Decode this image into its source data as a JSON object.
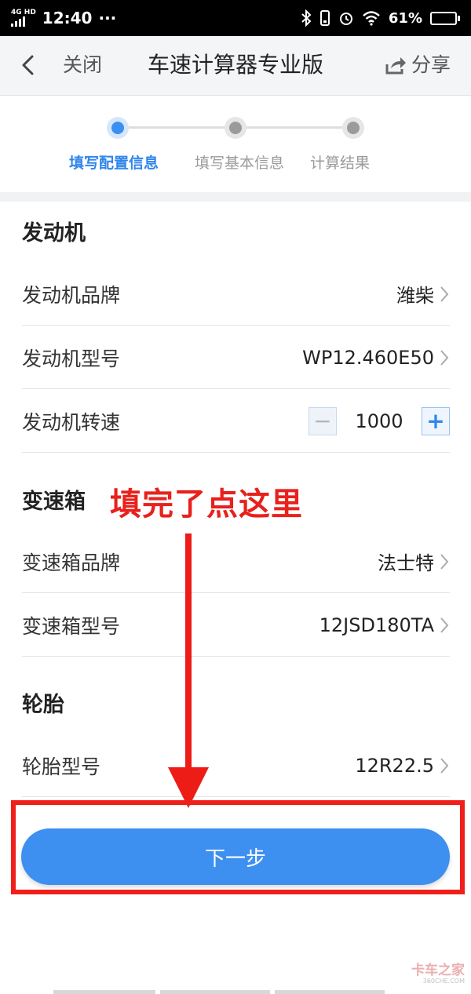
{
  "status_bar": {
    "network": "4G HD",
    "time": "12:40",
    "more": "···",
    "battery_percent": "61%",
    "battery_level": 0.61
  },
  "nav": {
    "close_label": "关闭",
    "title": "车速计算器专业版",
    "share_label": "分享"
  },
  "steps": [
    {
      "label": "填写配置信息",
      "active": true
    },
    {
      "label": "填写基本信息",
      "active": false
    },
    {
      "label": "计算结果",
      "active": false
    }
  ],
  "engine": {
    "section_title": "发动机",
    "brand_label": "发动机品牌",
    "brand_value": "潍柴",
    "model_label": "发动机型号",
    "model_value": "WP12.460E50",
    "speed_label": "发动机转速",
    "speed_value": "1000",
    "minus_symbol": "−",
    "plus_symbol": "+"
  },
  "gearbox": {
    "section_title": "变速箱",
    "brand_label": "变速箱品牌",
    "brand_value": "法士特",
    "model_label": "变速箱型号",
    "model_value": "12JSD180TA"
  },
  "tire": {
    "section_title": "轮胎",
    "model_label": "轮胎型号",
    "model_value": "12R22.5"
  },
  "annotation": {
    "text": "填完了点这里",
    "color": "#e8211c"
  },
  "next_button": {
    "label": "下一步",
    "color": "#3d8ff0"
  },
  "watermark": {
    "text": "卡车之家",
    "url_text": "360CHE.COM"
  },
  "colors": {
    "accent": "#2f86eb",
    "highlight_frame": "#f01f1a"
  }
}
